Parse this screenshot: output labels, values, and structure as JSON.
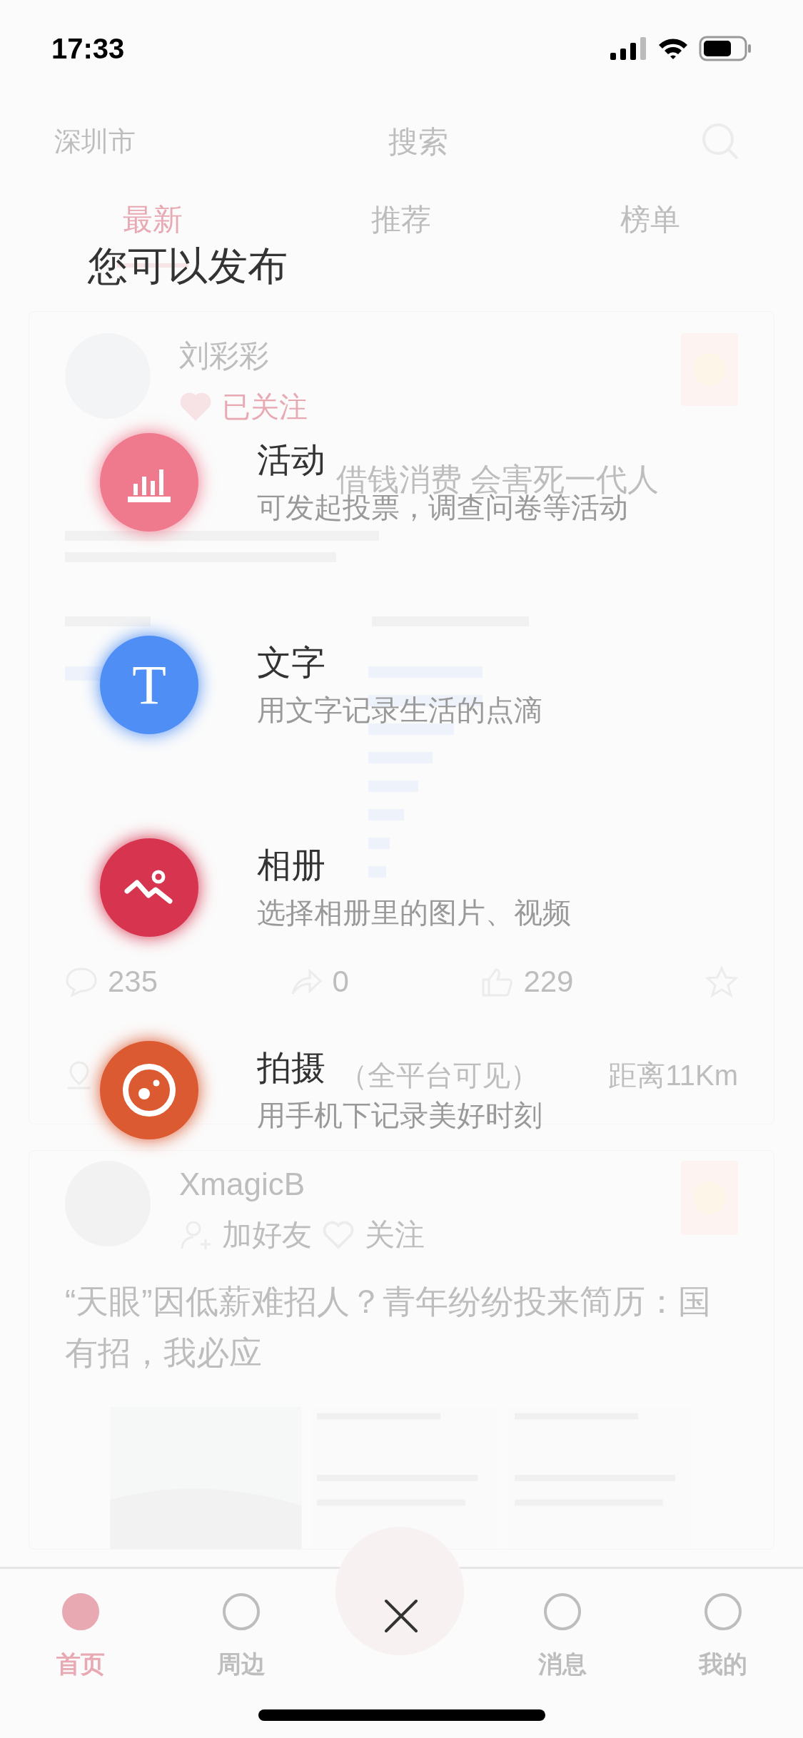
{
  "status_bar": {
    "time": "17:33"
  },
  "background": {
    "header": {
      "city": "深圳市",
      "title": "搜索"
    },
    "tabs": [
      {
        "label": "最新",
        "selected": true
      },
      {
        "label": "推荐",
        "selected": false
      },
      {
        "label": "榜单",
        "selected": false
      }
    ],
    "posts": [
      {
        "author": "刘彩彩",
        "follow": {
          "label": "已关注",
          "followed": true
        },
        "title": "借钱消费 会害死一代人",
        "stats": {
          "comments": "235",
          "shares": "0",
          "likes": "229"
        },
        "location": "（全平台可见）",
        "distance": "距离11Km"
      },
      {
        "author": "XmagicB",
        "add_friend": "加好友",
        "follow": {
          "label": "关注",
          "followed": false
        },
        "title": "“天眼”因低薪难招人？青年纷纷投来简历：国有招，我必应"
      }
    ],
    "tab_bar": [
      {
        "label": "首页",
        "selected": true
      },
      {
        "label": "周边",
        "selected": false
      },
      {
        "label": "消息",
        "selected": false
      },
      {
        "label": "我的",
        "selected": false
      }
    ]
  },
  "sheet": {
    "title": "您可以发布",
    "options": [
      {
        "kind": "activity",
        "title": "活动",
        "subtitle": "可发起投票，调查问卷等活动",
        "color": "#ef7a8e"
      },
      {
        "kind": "text",
        "icon_text": "T",
        "title": "文字",
        "subtitle": "用文字记录生活的点滴",
        "color": "#4f8ff5"
      },
      {
        "kind": "album",
        "title": "相册",
        "subtitle": "选择相册里的图片、视频",
        "color": "#d6344f"
      },
      {
        "kind": "camera",
        "title": "拍摄",
        "subtitle": "用手机下记录美好时刻",
        "color": "#dc5a32"
      }
    ]
  }
}
